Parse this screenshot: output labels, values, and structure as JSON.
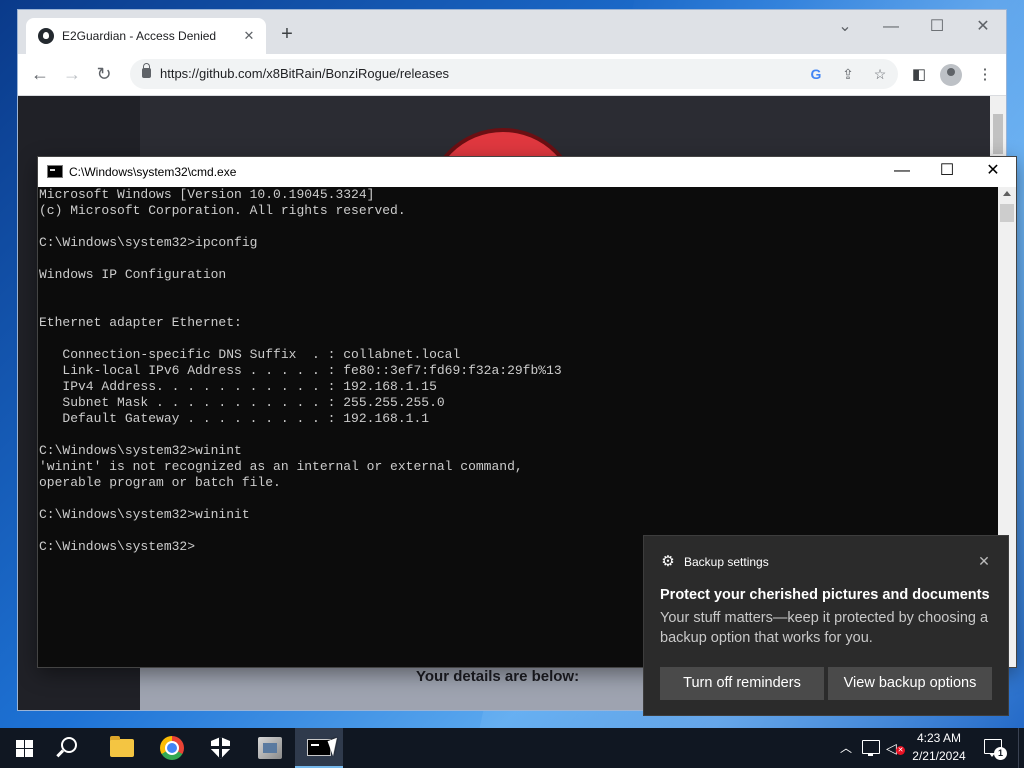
{
  "browser": {
    "tab_title": "E2Guardian - Access Denied",
    "url": "https://github.com/x8BitRain/BonziRogue/releases",
    "tab_close": "✕",
    "new_tab": "+",
    "page": {
      "details_text": "Your details are below:"
    }
  },
  "cmd": {
    "title": "C:\\Windows\\system32\\cmd.exe",
    "output_lines": [
      "Microsoft Windows [Version 10.0.19045.3324]",
      "(c) Microsoft Corporation. All rights reserved.",
      "",
      "C:\\Windows\\system32>ipconfig",
      "",
      "Windows IP Configuration",
      "",
      "",
      "Ethernet adapter Ethernet:",
      "",
      "   Connection-specific DNS Suffix  . : collabnet.local",
      "   Link-local IPv6 Address . . . . . : fe80::3ef7:fd69:f32a:29fb%13",
      "   IPv4 Address. . . . . . . . . . . : 192.168.1.15",
      "   Subnet Mask . . . . . . . . . . . : 255.255.255.0",
      "   Default Gateway . . . . . . . . . : 192.168.1.1",
      "",
      "C:\\Windows\\system32>winint",
      "'winint' is not recognized as an internal or external command,",
      "operable program or batch file.",
      "",
      "C:\\Windows\\system32>wininit",
      "",
      "C:\\Windows\\system32>"
    ]
  },
  "toast": {
    "app_name": "Backup settings",
    "heading": "Protect your cherished pictures and documents",
    "body": "Your stuff matters—keep it protected by choosing a backup option that works for you.",
    "btn_reminders": "Turn off reminders",
    "btn_view": "View backup options"
  },
  "taskbar": {
    "time": "4:23 AM",
    "date": "2/21/2024",
    "notification_count": "1"
  },
  "colors": {
    "cmd_text": "#cccccc",
    "cmd_bg": "#0c0c0c",
    "toast_bg": "#2b2b2b",
    "taskbar_bg": "#101722"
  }
}
